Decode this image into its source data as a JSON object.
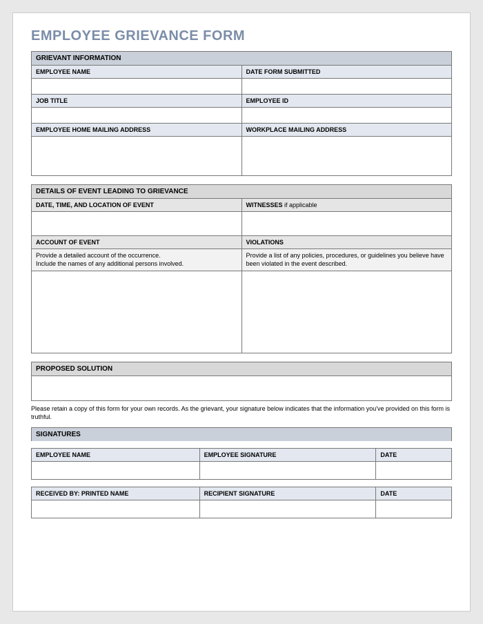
{
  "title": "EMPLOYEE GRIEVANCE FORM",
  "section1": {
    "header": "GRIEVANT INFORMATION",
    "employee_name": "EMPLOYEE NAME",
    "date_submitted": "DATE FORM SUBMITTED",
    "job_title": "JOB TITLE",
    "employee_id": "EMPLOYEE ID",
    "home_addr": "EMPLOYEE HOME MAILING ADDRESS",
    "work_addr": "WORKPLACE MAILING ADDRESS"
  },
  "section2": {
    "header": "DETAILS OF EVENT LEADING TO GRIEVANCE",
    "datetime": "DATE, TIME, AND LOCATION OF EVENT",
    "witnesses": "WITNESSES",
    "witnesses_note": " if applicable",
    "account": "ACCOUNT OF EVENT",
    "account_hint": "Provide a detailed account of the occurrence.\nInclude the names of any additional persons involved.",
    "violations": "VIOLATIONS",
    "violations_hint": "Provide a list of any policies, procedures, or guidelines you believe have been violated in the event described."
  },
  "section3": {
    "header": "PROPOSED SOLUTION"
  },
  "disclaimer": "Please retain a copy of this form for your own records.  As the grievant, your signature below indicates that the information you've provided on this form is truthful.",
  "section4": {
    "header": "SIGNATURES",
    "emp_name": "EMPLOYEE NAME",
    "emp_sig": "EMPLOYEE SIGNATURE",
    "date": "DATE",
    "recv_name": "RECEIVED BY: PRINTED NAME",
    "recv_sig": "RECIPIENT SIGNATURE"
  }
}
